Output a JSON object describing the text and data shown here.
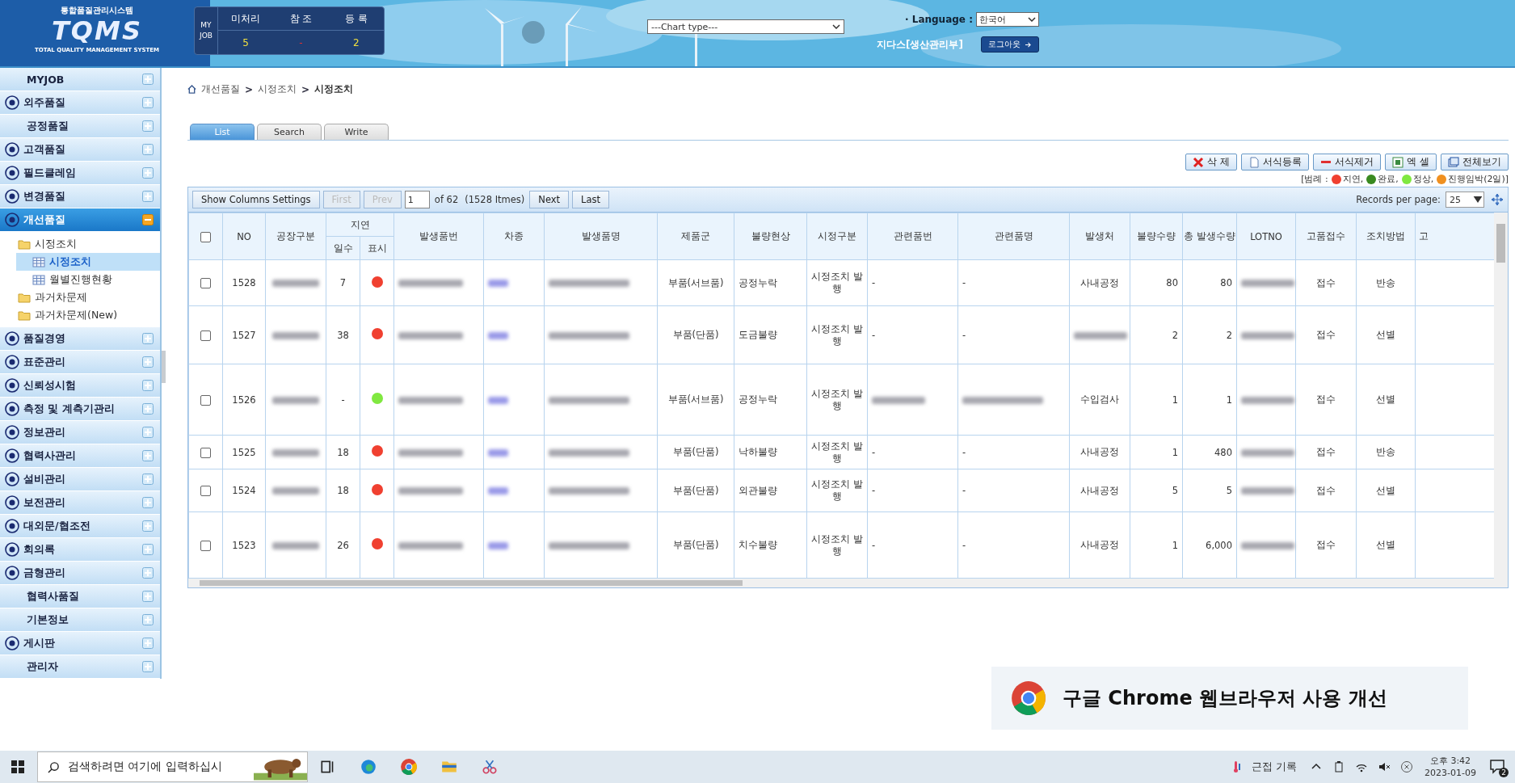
{
  "header": {
    "logo_top": "통합품질관리시스템",
    "logo": "TQMS",
    "logo_sub": "TOTAL QUALITY MANAGEMENT SYSTEM",
    "myjob": {
      "label": "MY JOB",
      "columns": [
        {
          "label": "미처리",
          "value": "5",
          "color": "#f0e040"
        },
        {
          "label": "참 조",
          "value": "-",
          "color": "#e03030"
        },
        {
          "label": "등 록",
          "value": "2",
          "color": "#f0e040"
        }
      ]
    },
    "chart_type": "---Chart type---",
    "language_label": "· Language :",
    "language": "한국어",
    "user": "지다스[생산관리부]",
    "logout": "로그아웃"
  },
  "sidebar": [
    {
      "label": "MYJOB",
      "has_icon": false,
      "expanded": false
    },
    {
      "label": "외주품질",
      "has_icon": true,
      "expanded": false
    },
    {
      "label": "공정품질",
      "has_icon": false,
      "expanded": false
    },
    {
      "label": "고객품질",
      "has_icon": true,
      "expanded": false
    },
    {
      "label": "필드클레임",
      "has_icon": true,
      "expanded": false
    },
    {
      "label": "변경품질",
      "has_icon": true,
      "expanded": false
    },
    {
      "label": "개선품질",
      "has_icon": true,
      "expanded": true,
      "children": [
        {
          "label": "시정조치",
          "kind": "folder",
          "selected": false,
          "children": [
            {
              "label": "시정조치",
              "kind": "page",
              "selected": true
            },
            {
              "label": "월별진행현황",
              "kind": "page",
              "selected": false
            }
          ]
        },
        {
          "label": "과거차문제",
          "kind": "folder",
          "selected": false
        },
        {
          "label": "과거차문제(New)",
          "kind": "folder",
          "selected": false
        }
      ]
    },
    {
      "label": "품질경영",
      "has_icon": true,
      "expanded": false
    },
    {
      "label": "표준관리",
      "has_icon": true,
      "expanded": false
    },
    {
      "label": "신뢰성시험",
      "has_icon": true,
      "expanded": false
    },
    {
      "label": "측정 및 계측기관리",
      "has_icon": true,
      "expanded": false
    },
    {
      "label": "정보관리",
      "has_icon": true,
      "expanded": false
    },
    {
      "label": "협력사관리",
      "has_icon": true,
      "expanded": false
    },
    {
      "label": "설비관리",
      "has_icon": true,
      "expanded": false
    },
    {
      "label": "보전관리",
      "has_icon": true,
      "expanded": false
    },
    {
      "label": "대외문/협조전",
      "has_icon": true,
      "expanded": false
    },
    {
      "label": "회의록",
      "has_icon": true,
      "expanded": false
    },
    {
      "label": "금형관리",
      "has_icon": true,
      "expanded": false
    },
    {
      "label": "협력사품질",
      "has_icon": false,
      "expanded": false
    },
    {
      "label": "기본정보",
      "has_icon": false,
      "expanded": false
    },
    {
      "label": "게시판",
      "has_icon": true,
      "expanded": false
    },
    {
      "label": "관리자",
      "has_icon": false,
      "expanded": false
    }
  ],
  "breadcrumb": [
    {
      "label": "개선품질"
    },
    {
      "separator": ">",
      "label": "시정조치"
    },
    {
      "separator": ">",
      "label": "시정조치"
    }
  ],
  "tabs": [
    {
      "label": "List",
      "selected": true
    },
    {
      "label": "Search",
      "selected": false
    },
    {
      "label": "Write",
      "selected": false
    }
  ],
  "actions": [
    {
      "label": "삭 제",
      "kind": "delete"
    },
    {
      "label": "서식등록",
      "kind": "doc"
    },
    {
      "label": "서식제거",
      "kind": "remove"
    },
    {
      "label": "엑 셀",
      "kind": "excel"
    },
    {
      "label": "전체보기",
      "kind": "window"
    }
  ],
  "legend": {
    "label": "[범례 :",
    "items": [
      {
        "label": "지연,",
        "color": "#f04030"
      },
      {
        "label": "완료,",
        "color": "#3a8a20"
      },
      {
        "label": "정상,",
        "color": "#80e840"
      },
      {
        "label": "진행임박(2일)]",
        "color": "#f09020"
      }
    ]
  },
  "pager": {
    "columns_button": "Show Columns Settings",
    "first": "First",
    "prev": "Prev",
    "first_disabled": true,
    "prev_disabled": true,
    "page": "1",
    "of": "of 62",
    "total": "(1528 Itmes)",
    "next": "Next",
    "last": "Last",
    "records_label": "Records per page:",
    "records": "25"
  },
  "table": {
    "select_all_checked": false,
    "group_header": "지연",
    "columns": [
      "NO",
      "공장구분",
      "일수",
      "표시",
      "발생품번",
      "차종",
      "발생품명",
      "제품군",
      "불량현상",
      "시정구분",
      "관련품번",
      "관련품명",
      "발생처",
      "불량수량",
      "총 발생수량",
      "LOTNO",
      "고품접수",
      "조치방법",
      "고"
    ],
    "rows": [
      {
        "checked": false,
        "no": "1528",
        "days": "7",
        "color": "#f04030",
        "group": "부품(서브품)",
        "defect": "공정누락",
        "type": "시정조치 발행",
        "related_blurred": false,
        "related_no": "-",
        "related_name": "-",
        "source_blurred": false,
        "source": "사내공정",
        "defect_qty": "80",
        "total_qty": "80",
        "receipt": "접수",
        "method": "반송"
      },
      {
        "checked": false,
        "no": "1527",
        "days": "38",
        "color": "#f04030",
        "group": "부품(단품)",
        "defect": "도금불량",
        "type": "시정조치 발행",
        "related_blurred": false,
        "related_no": "-",
        "related_name": "-",
        "source_blurred": true,
        "defect_qty": "2",
        "total_qty": "2",
        "receipt": "접수",
        "method": "선별"
      },
      {
        "checked": false,
        "no": "1526",
        "days": "-",
        "color": "#80e840",
        "group": "부품(서브품)",
        "defect": "공정누락",
        "type": "시정조치 발행",
        "related_blurred": true,
        "source_blurred": false,
        "source": "수입검사",
        "defect_qty": "1",
        "total_qty": "1",
        "receipt": "접수",
        "method": "선별"
      },
      {
        "checked": false,
        "no": "1525",
        "days": "18",
        "color": "#f04030",
        "group": "부품(단품)",
        "defect": "낙하불량",
        "type": "시정조치 발행",
        "related_blurred": false,
        "related_no": "-",
        "related_name": "-",
        "source_blurred": false,
        "source": "사내공정",
        "defect_qty": "1",
        "total_qty": "480",
        "receipt": "접수",
        "method": "반송"
      },
      {
        "checked": false,
        "no": "1524",
        "days": "18",
        "color": "#f04030",
        "group": "부품(단품)",
        "defect": "외관불량",
        "type": "시정조치 발행",
        "related_blurred": false,
        "related_no": "-",
        "related_name": "-",
        "source_blurred": false,
        "source": "사내공정",
        "defect_qty": "5",
        "total_qty": "5",
        "receipt": "접수",
        "method": "선별"
      },
      {
        "checked": false,
        "no": "1523",
        "days": "26",
        "color": "#f04030",
        "group": "부품(단품)",
        "defect": "치수불량",
        "type": "시정조치 발행",
        "related_blurred": false,
        "related_no": "-",
        "related_name": "-",
        "source_blurred": false,
        "source": "사내공정",
        "defect_qty": "1",
        "total_qty": "6,000",
        "receipt": "접수",
        "method": "선별"
      }
    ]
  },
  "banner": "구글 Chrome 웹브라우저 사용 개선",
  "taskbar": {
    "search_placeholder": "검색하려면 여기에 입력하십시",
    "weather": "근접 기록",
    "time": "오후 3:42",
    "date": "2023-01-09",
    "notifications": "2"
  }
}
